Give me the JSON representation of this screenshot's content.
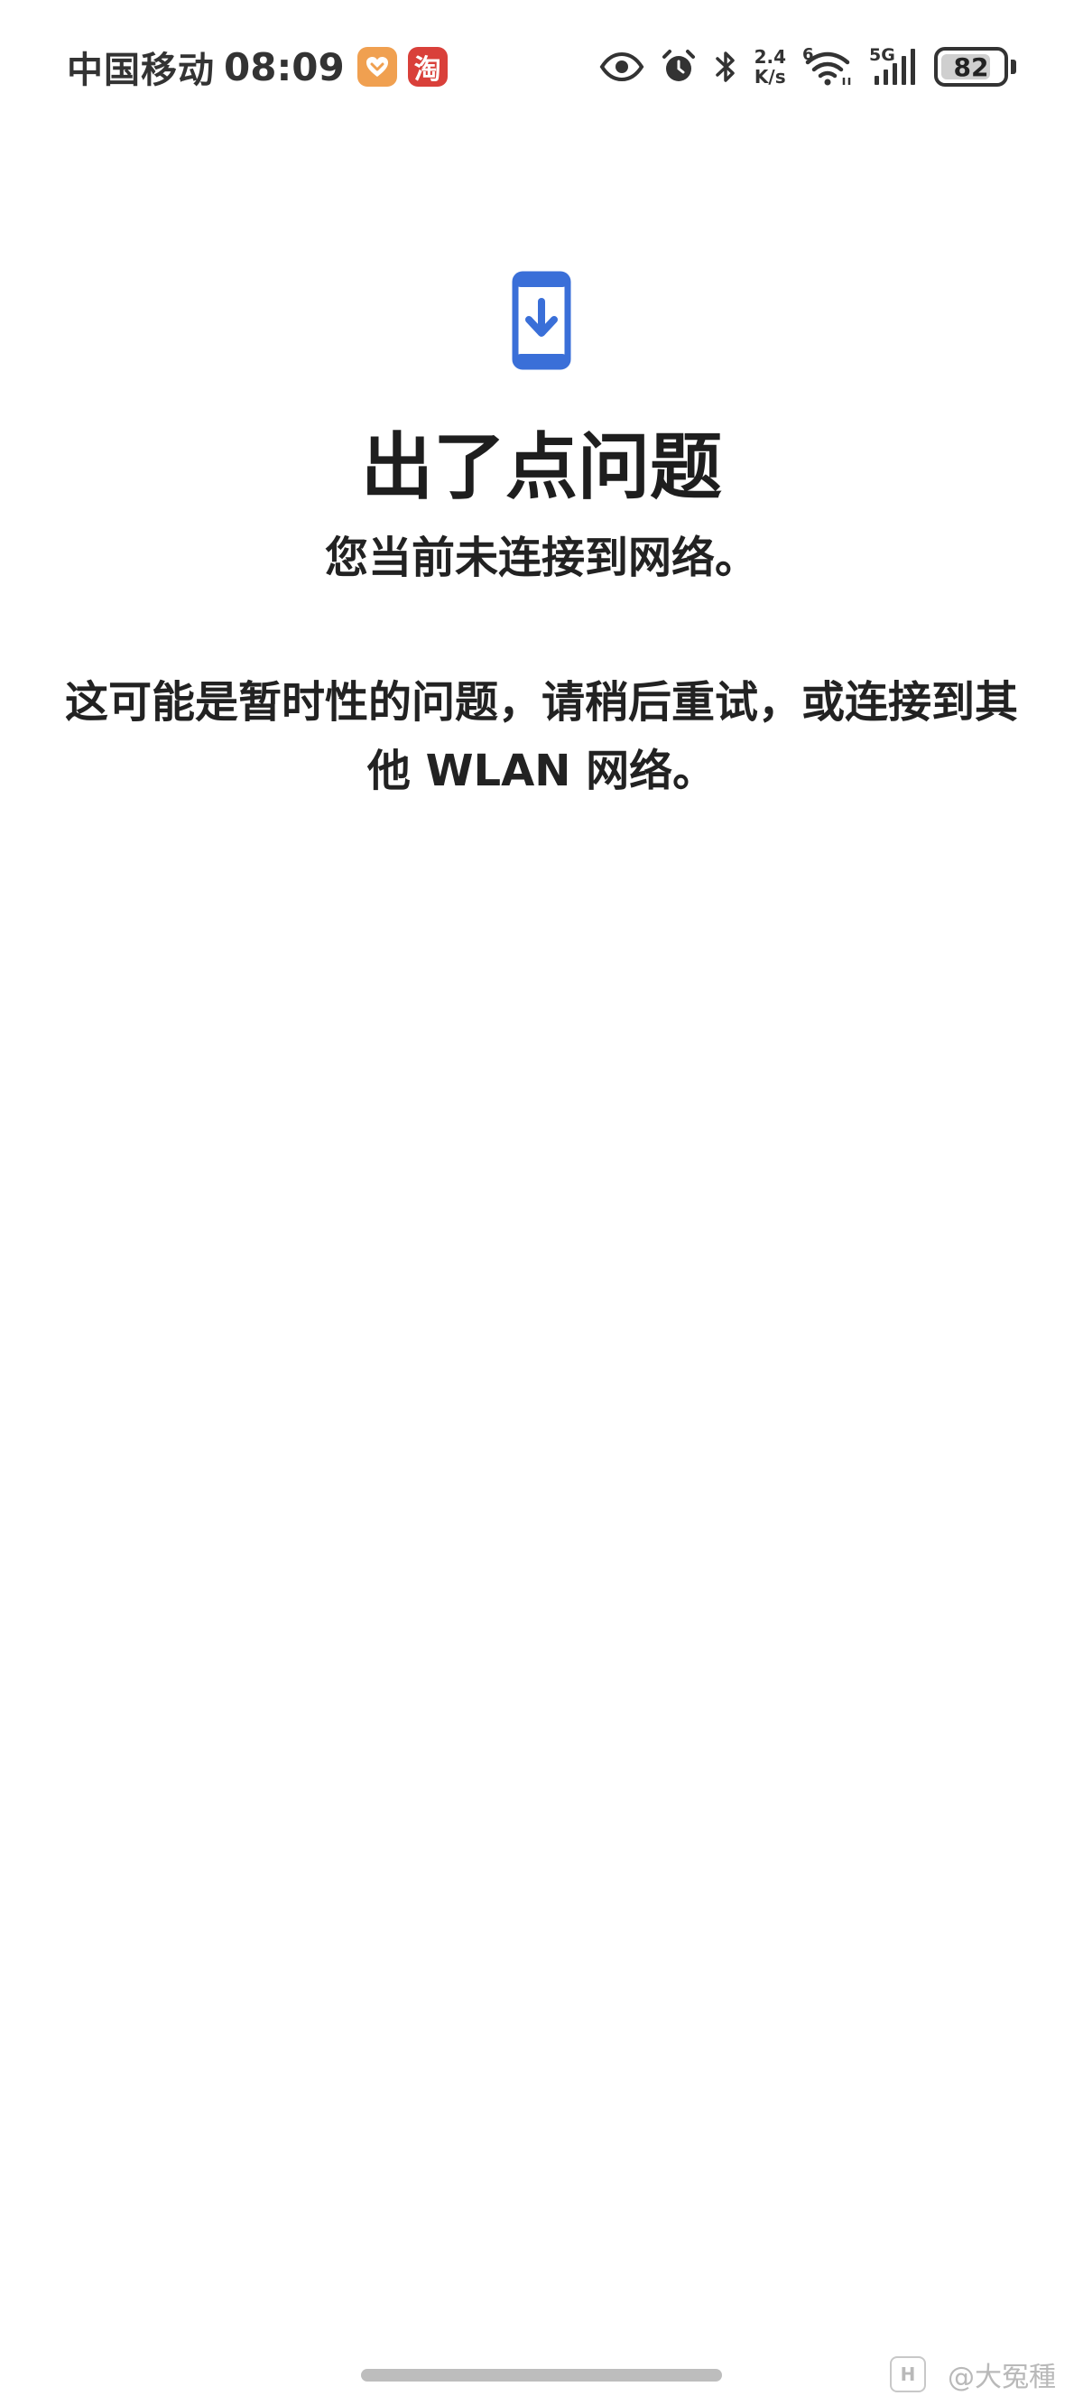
{
  "status_bar": {
    "carrier": "中国移动",
    "time": "08:09",
    "notification_icons": [
      "health-app-icon",
      "taobao-icon"
    ],
    "taobao_label": "淘",
    "net_speed_value": "2.4",
    "net_speed_unit": "K/s",
    "wifi_label": "6",
    "network_type": "5G",
    "battery_percent": "82",
    "battery_level": 0.82,
    "indicator_icons": [
      "eye-icon",
      "alarm-icon",
      "bluetooth-icon",
      "wifi-icon",
      "signal-icon",
      "battery-icon"
    ]
  },
  "error": {
    "icon": "phone-download-icon",
    "icon_color": "#3a6fd8",
    "title": "出了点问题",
    "subtitle": "您当前未连接到网络。",
    "detail": "这可能是暂时性的问题，请稍后重试，或连接到其他 WLAN 网络。"
  },
  "watermark": {
    "badge": "H",
    "text": "@大冤種"
  }
}
